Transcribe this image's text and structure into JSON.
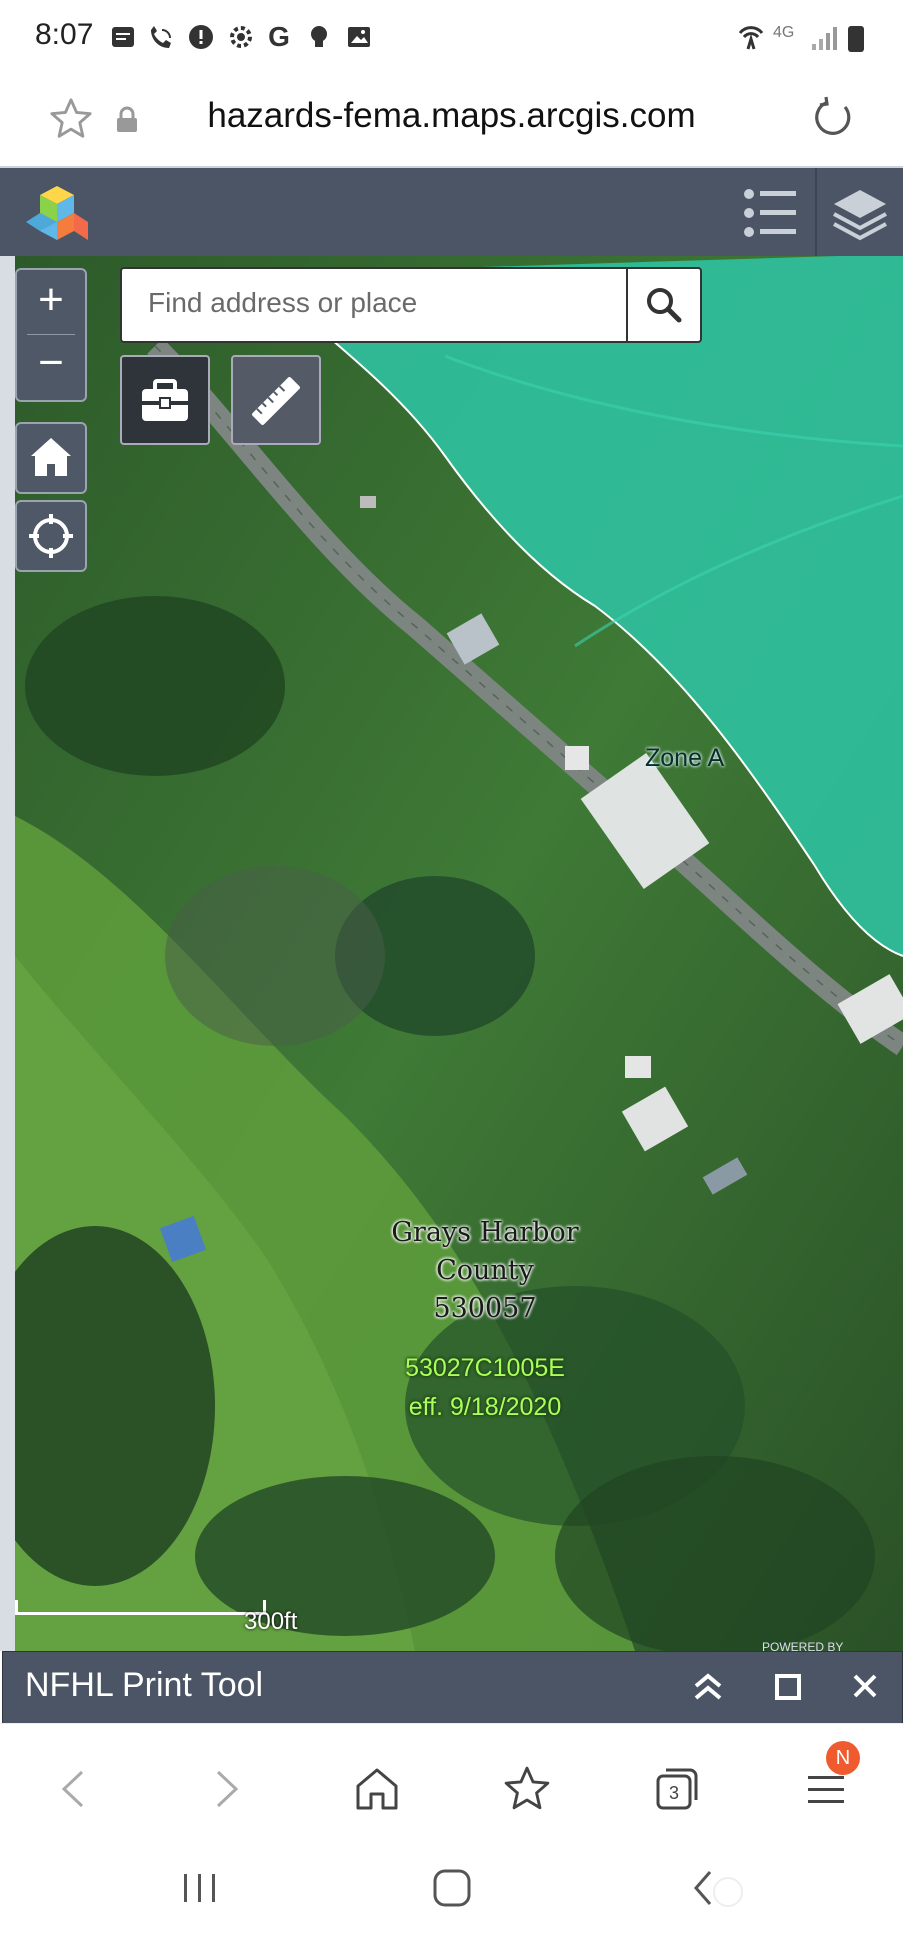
{
  "status_bar": {
    "time": "8:07",
    "network": "4G",
    "icons": [
      "message-icon",
      "wifi-call-icon",
      "alert-icon",
      "settings-icon",
      "google-icon",
      "bulb-icon",
      "image-icon",
      "hotspot-icon",
      "signal-icon",
      "battery-icon"
    ]
  },
  "url_bar": {
    "url": "hazards-fema.maps.arcgis.com",
    "icons": [
      "star-icon",
      "lock-icon",
      "reload-icon"
    ]
  },
  "app_header": {
    "icons": [
      "app-logo-icon",
      "legend-list-icon",
      "layers-icon"
    ]
  },
  "map": {
    "search_placeholder": "Find address or place",
    "zoom_in": "+",
    "zoom_out": "−",
    "zone_label": "Zone A",
    "county_line1": "Grays Harbor",
    "county_line2": "County",
    "county_line3": "530057",
    "panel_id": "53027C1005E",
    "panel_eff": "eff. 9/18/2020",
    "scale_label": "300ft",
    "powered_by": "POWERED BY",
    "colors": {
      "flood_zone": "#2fbf9c",
      "panel_label": "#a8ff5a"
    }
  },
  "nfhl_panel": {
    "title": "NFHL Print Tool"
  },
  "browser_nav": {
    "tabs_count": "3",
    "menu_badge": "N"
  }
}
